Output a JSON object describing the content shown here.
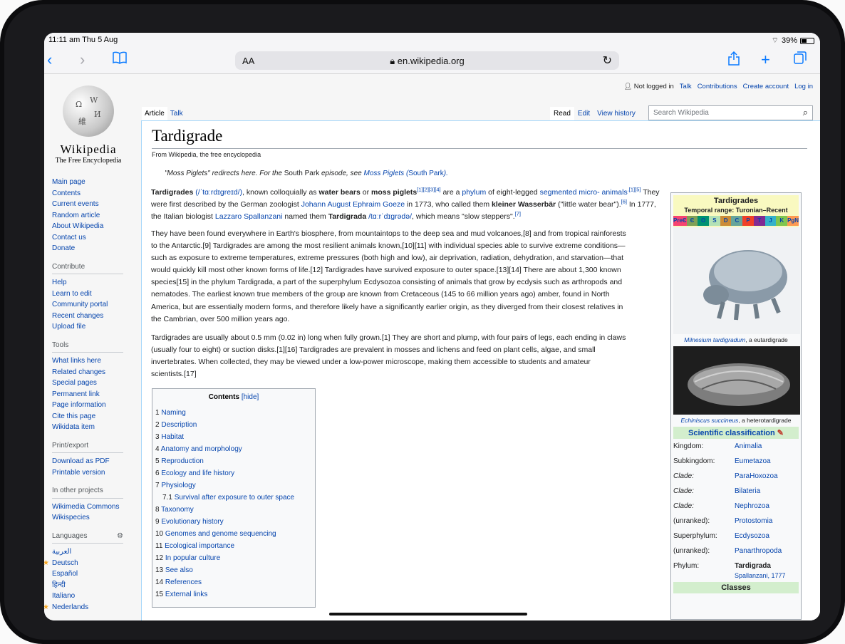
{
  "status": {
    "time": "11:11 am  Thu 5 Aug",
    "battery": "39%"
  },
  "browser": {
    "text_size": "AA",
    "url": "en.wikipedia.org"
  },
  "wiki": {
    "logo": {
      "wordmark": "Wikipedia",
      "tagline": "The Free Encyclopedia"
    },
    "personal": {
      "not_logged": "Not logged in",
      "talk": "Talk",
      "contributions": "Contributions",
      "create_account": "Create account",
      "login": "Log in"
    },
    "tabs": {
      "article": "Article",
      "talk": "Talk",
      "read": "Read",
      "edit": "Edit",
      "history": "View history"
    },
    "search_placeholder": "Search Wikipedia",
    "sidebar": {
      "nav": [
        "Main page",
        "Contents",
        "Current events",
        "Random article",
        "About Wikipedia",
        "Contact us",
        "Donate"
      ],
      "contribute_head": "Contribute",
      "contribute": [
        "Help",
        "Learn to edit",
        "Community portal",
        "Recent changes",
        "Upload file"
      ],
      "tools_head": "Tools",
      "tools": [
        "What links here",
        "Related changes",
        "Special pages",
        "Permanent link",
        "Page information",
        "Cite this page",
        "Wikidata item"
      ],
      "print_head": "Print/export",
      "print": [
        "Download as PDF",
        "Printable version"
      ],
      "projects_head": "In other projects",
      "projects": [
        "Wikimedia Commons",
        "Wikispecies"
      ],
      "languages_head": "Languages",
      "languages": [
        "العربية",
        "Deutsch",
        "Español",
        "हिन्दी",
        "Italiano",
        "Nederlands"
      ]
    },
    "article": {
      "title": "Tardigrade",
      "from": "From Wikipedia, the free encyclopedia",
      "hatnote_a": "\"Moss Piglets\" redirects here. For the",
      "hatnote_b": "South Park",
      "hatnote_c": "episode, see",
      "hatnote_link": "Moss Piglets (",
      "hatnote_link2": "South Park",
      "hatnote_end": ").",
      "p1": {
        "a": "Tardigrades",
        "b": "(/ˈtɑːrdɪɡreɪd/)",
        "c": ", known colloquially as",
        "d": "water bears",
        "e": "or",
        "f": "moss piglets",
        "g": "[1][2][3][4]",
        "h": "are a",
        "i": "phylum",
        "j": "of eight-legged",
        "k": "segmented micro-",
        "l": "animals",
        "m": ".[1][5]",
        "n": "They were first described by the German zoologist",
        "o": "Johann August Ephraim Goeze",
        "p": "in 1773, who called them",
        "q": "kleiner Wasserbär",
        "r": "(\"little water bear\").",
        "s": "[6]",
        "t": "In 1777, the Italian biologist",
        "u": "Lazzaro Spallanzani",
        "v": "named them",
        "w": "Tardigrada",
        "x": "/tɑːrˈdɪɡrədə/",
        "y": ", which means \"slow steppers\".",
        "z": "[7]"
      },
      "p2_lines": [
        "They have been found everywhere in Earth's biosphere, from mountaintops to the deep sea and mud volcanoes,[8] and from tropical rainforests",
        "to the Antarctic.[9] Tardigrades are among the most resilient animals known,[10][11] with individual species able to survive extreme conditions—",
        "such as exposure to extreme temperatures, extreme pressures (both high and low), air deprivation, radiation, dehydration, and starvation—that",
        "would quickly kill most other known forms of life.[12] Tardigrades have survived exposure to outer space.[13][14] There are about 1,300 known",
        "species[15] in the phylum Tardigrada, a part of the superphylum Ecdysozoa consisting of animals that grow by ecdysis such as arthropods and",
        "nematodes. The earliest known true members of the group are known from Cretaceous (145 to 66 million years ago) amber, found in North",
        "America, but are essentially modern forms, and therefore likely have a significantly earlier origin, as they diverged from their closest relatives in",
        "the Cambrian, over 500 million years ago."
      ],
      "p3_lines": [
        "Tardigrades are usually about 0.5 mm (0.02 in) long when fully grown.[1] They are short and plump, with four pairs of legs, each ending in claws",
        "(usually four to eight) or suction disks.[1][16] Tardigrades are prevalent in mosses and lichens and feed on plant cells, algae, and small",
        "invertebrates. When collected, they may be viewed under a low-power microscope, making them accessible to students and amateur",
        "scientists.[17]"
      ]
    },
    "toc": {
      "title": "Contents",
      "hide": "[hide]",
      "items": [
        {
          "num": "1",
          "label": "Naming"
        },
        {
          "num": "2",
          "label": "Description"
        },
        {
          "num": "3",
          "label": "Habitat"
        },
        {
          "num": "4",
          "label": "Anatomy and morphology"
        },
        {
          "num": "5",
          "label": "Reproduction"
        },
        {
          "num": "6",
          "label": "Ecology and life history"
        },
        {
          "num": "7",
          "label": "Physiology"
        },
        {
          "num": "7.1",
          "label": "Survival after exposure to outer space"
        },
        {
          "num": "8",
          "label": "Taxonomy"
        },
        {
          "num": "9",
          "label": "Evolutionary history"
        },
        {
          "num": "10",
          "label": "Genomes and genome sequencing"
        },
        {
          "num": "11",
          "label": "Ecological importance"
        },
        {
          "num": "12",
          "label": "In popular culture"
        },
        {
          "num": "13",
          "label": "See also"
        },
        {
          "num": "14",
          "label": "References"
        },
        {
          "num": "15",
          "label": "External links"
        }
      ]
    },
    "infobox": {
      "name": "Tardigrades",
      "range": "Temporal range: Turonian–Recent",
      "periods": [
        "PreЄ",
        "Є",
        "O",
        "S",
        "D",
        "C",
        "P",
        "T",
        "J",
        "K",
        "PgN"
      ],
      "caption1_a": "Milnesium tardigradum",
      "caption1_b": ", a eutardigrade",
      "caption2_a": "Echiniscus succineus",
      "caption2_b": ", a heterotardigrade",
      "classification_head": "Scientific classification",
      "rows": [
        {
          "k": "Kingdom:",
          "v": "Animalia"
        },
        {
          "k": "Subkingdom:",
          "v": "Eumetazoa"
        },
        {
          "k": "Clade:",
          "v": "ParaHoxozoa"
        },
        {
          "k": "Clade:",
          "v": "Bilateria"
        },
        {
          "k": "Clade:",
          "v": "Nephrozoa"
        },
        {
          "k": "(unranked):",
          "v": "Protostomia"
        },
        {
          "k": "Superphylum:",
          "v": "Ecdysozoa"
        },
        {
          "k": "(unranked):",
          "v": "Panarthropoda"
        },
        {
          "k": "Phylum:",
          "v": "Tardigrada"
        }
      ],
      "authority": "Spallanzani, 1777",
      "classes_head": "Classes"
    }
  }
}
